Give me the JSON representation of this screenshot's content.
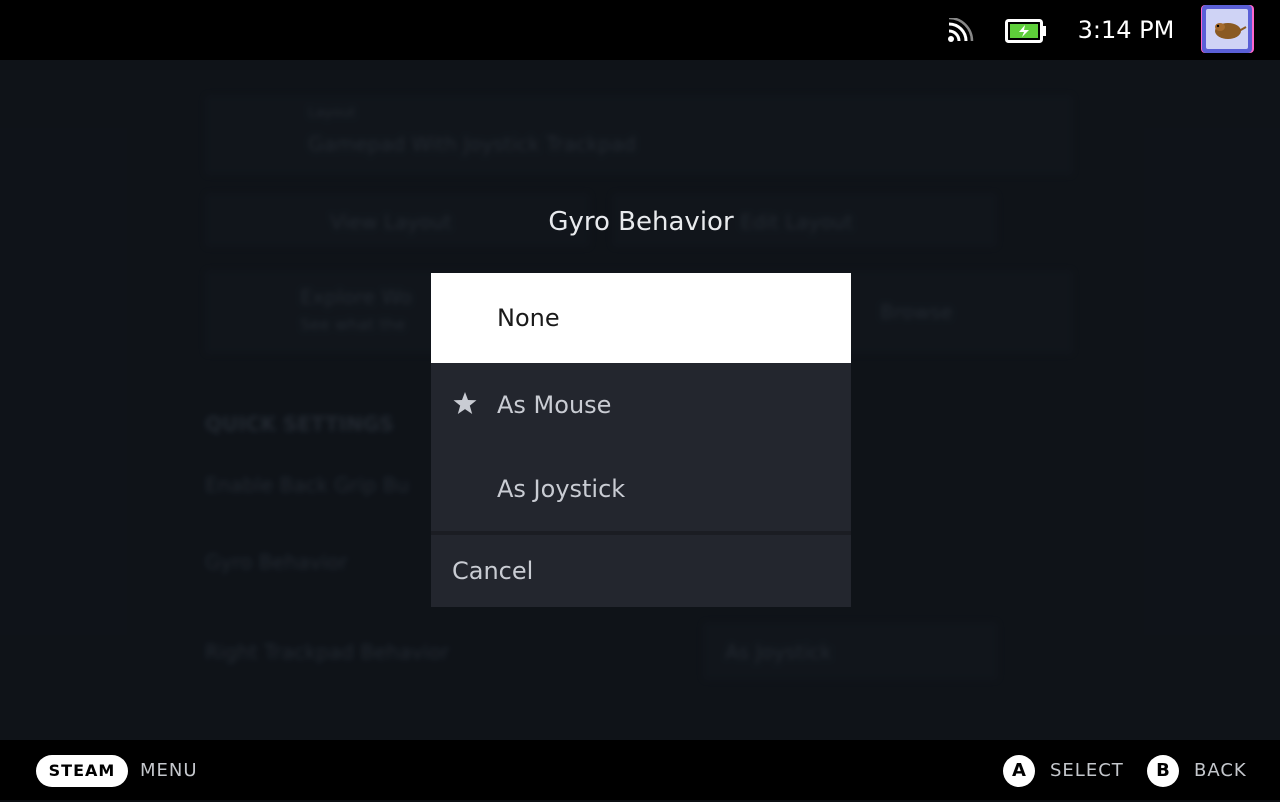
{
  "statusbar": {
    "time": "3:14 PM",
    "icons": [
      "wifi-icon",
      "battery-icon",
      "avatar"
    ]
  },
  "background": {
    "layout_value": "Gamepad With Joystick Trackpad",
    "layout_label": "Layout",
    "view_layout": "View Layout",
    "edit_layout": "Edit Layout",
    "explore_title": "Explore Wo",
    "explore_sub": "See what the",
    "browse": "Browse",
    "quick_settings": "QUICK SETTINGS",
    "back_grip": "Enable Back Grip Bu",
    "gyro_behavior": "Gyro Behavior",
    "right_trackpad": "Right Trackpad Behavior",
    "right_trackpad_value": "As Joystick"
  },
  "dialog": {
    "title": "Gyro Behavior",
    "options": [
      {
        "label": "None",
        "selected": true,
        "starred": false
      },
      {
        "label": "As Mouse",
        "selected": false,
        "starred": true
      },
      {
        "label": "As Joystick",
        "selected": false,
        "starred": false
      }
    ],
    "cancel": "Cancel"
  },
  "bottombar": {
    "steam": "STEAM",
    "menu": "MENU",
    "a_key": "A",
    "select": "SELECT",
    "b_key": "B",
    "back": "BACK"
  },
  "colors": {
    "accent_battery": "#5ecf3a",
    "dialog_bg": "#23262e",
    "selected_bg": "#ffffff"
  }
}
